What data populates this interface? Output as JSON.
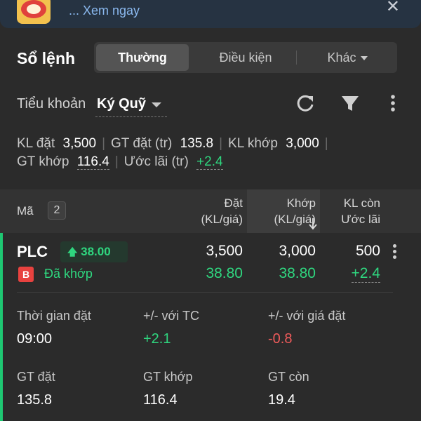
{
  "banner": {
    "text": "... Xem ngay",
    "close_symbol": "✕"
  },
  "header": {
    "title": "Sổ lệnh",
    "tabs": [
      {
        "label": "Thường",
        "active": true
      },
      {
        "label": "Điều kiện",
        "active": false
      },
      {
        "label": "Khác",
        "active": false
      }
    ]
  },
  "account": {
    "label": "Tiểu khoản",
    "value": "Ký Quỹ",
    "icons": [
      "refresh-icon",
      "filter-icon",
      "more-vertical-icon"
    ]
  },
  "summary": {
    "kl_dat_label": "KL đặt",
    "kl_dat": "3,500",
    "gt_dat_label": "GT đặt (tr)",
    "gt_dat": "135.8",
    "kl_khop_label": "KL khớp",
    "kl_khop": "3,000",
    "gt_khop_label": "GT khớp",
    "gt_khop": "116.4",
    "uoc_lai_label": "Ước lãi (tr)",
    "uoc_lai": "+2.4"
  },
  "table_header": {
    "ma": "Mã",
    "count": "2",
    "dat_line1": "Đặt",
    "dat_line2": "(KL/giá)",
    "khop_line1": "Khớp",
    "khop_line2": "(KL/giá)",
    "con_line1": "KL còn",
    "con_line2": "Ước lãi"
  },
  "order": {
    "symbol": "PLC",
    "price": "38.00",
    "price_arrow": "🡅",
    "side": "B",
    "status": "Đã khớp",
    "dat_kl": "3,500",
    "dat_gia": "38.80",
    "khop_kl": "3,000",
    "khop_gia": "38.80",
    "kl_con": "500",
    "uoc_lai": "+2.4",
    "details": {
      "thoi_gian_dat_label": "Thời gian đặt",
      "thoi_gian_dat": "09:00",
      "vs_tc_label": "+/- với TC",
      "vs_tc": "+2.1",
      "vs_gia_dat_label": "+/- với giá đặt",
      "vs_gia_dat": "-0.8",
      "gt_dat_label": "GT đặt",
      "gt_dat": "135.8",
      "gt_khop_label": "GT khớp",
      "gt_khop": "116.4",
      "gt_con_label": "GT còn",
      "gt_con": "19.4"
    }
  },
  "colors": {
    "up": "#2fd67f",
    "down": "#f05b5b",
    "buy": "#e8423f",
    "accent": "#1ec772"
  }
}
